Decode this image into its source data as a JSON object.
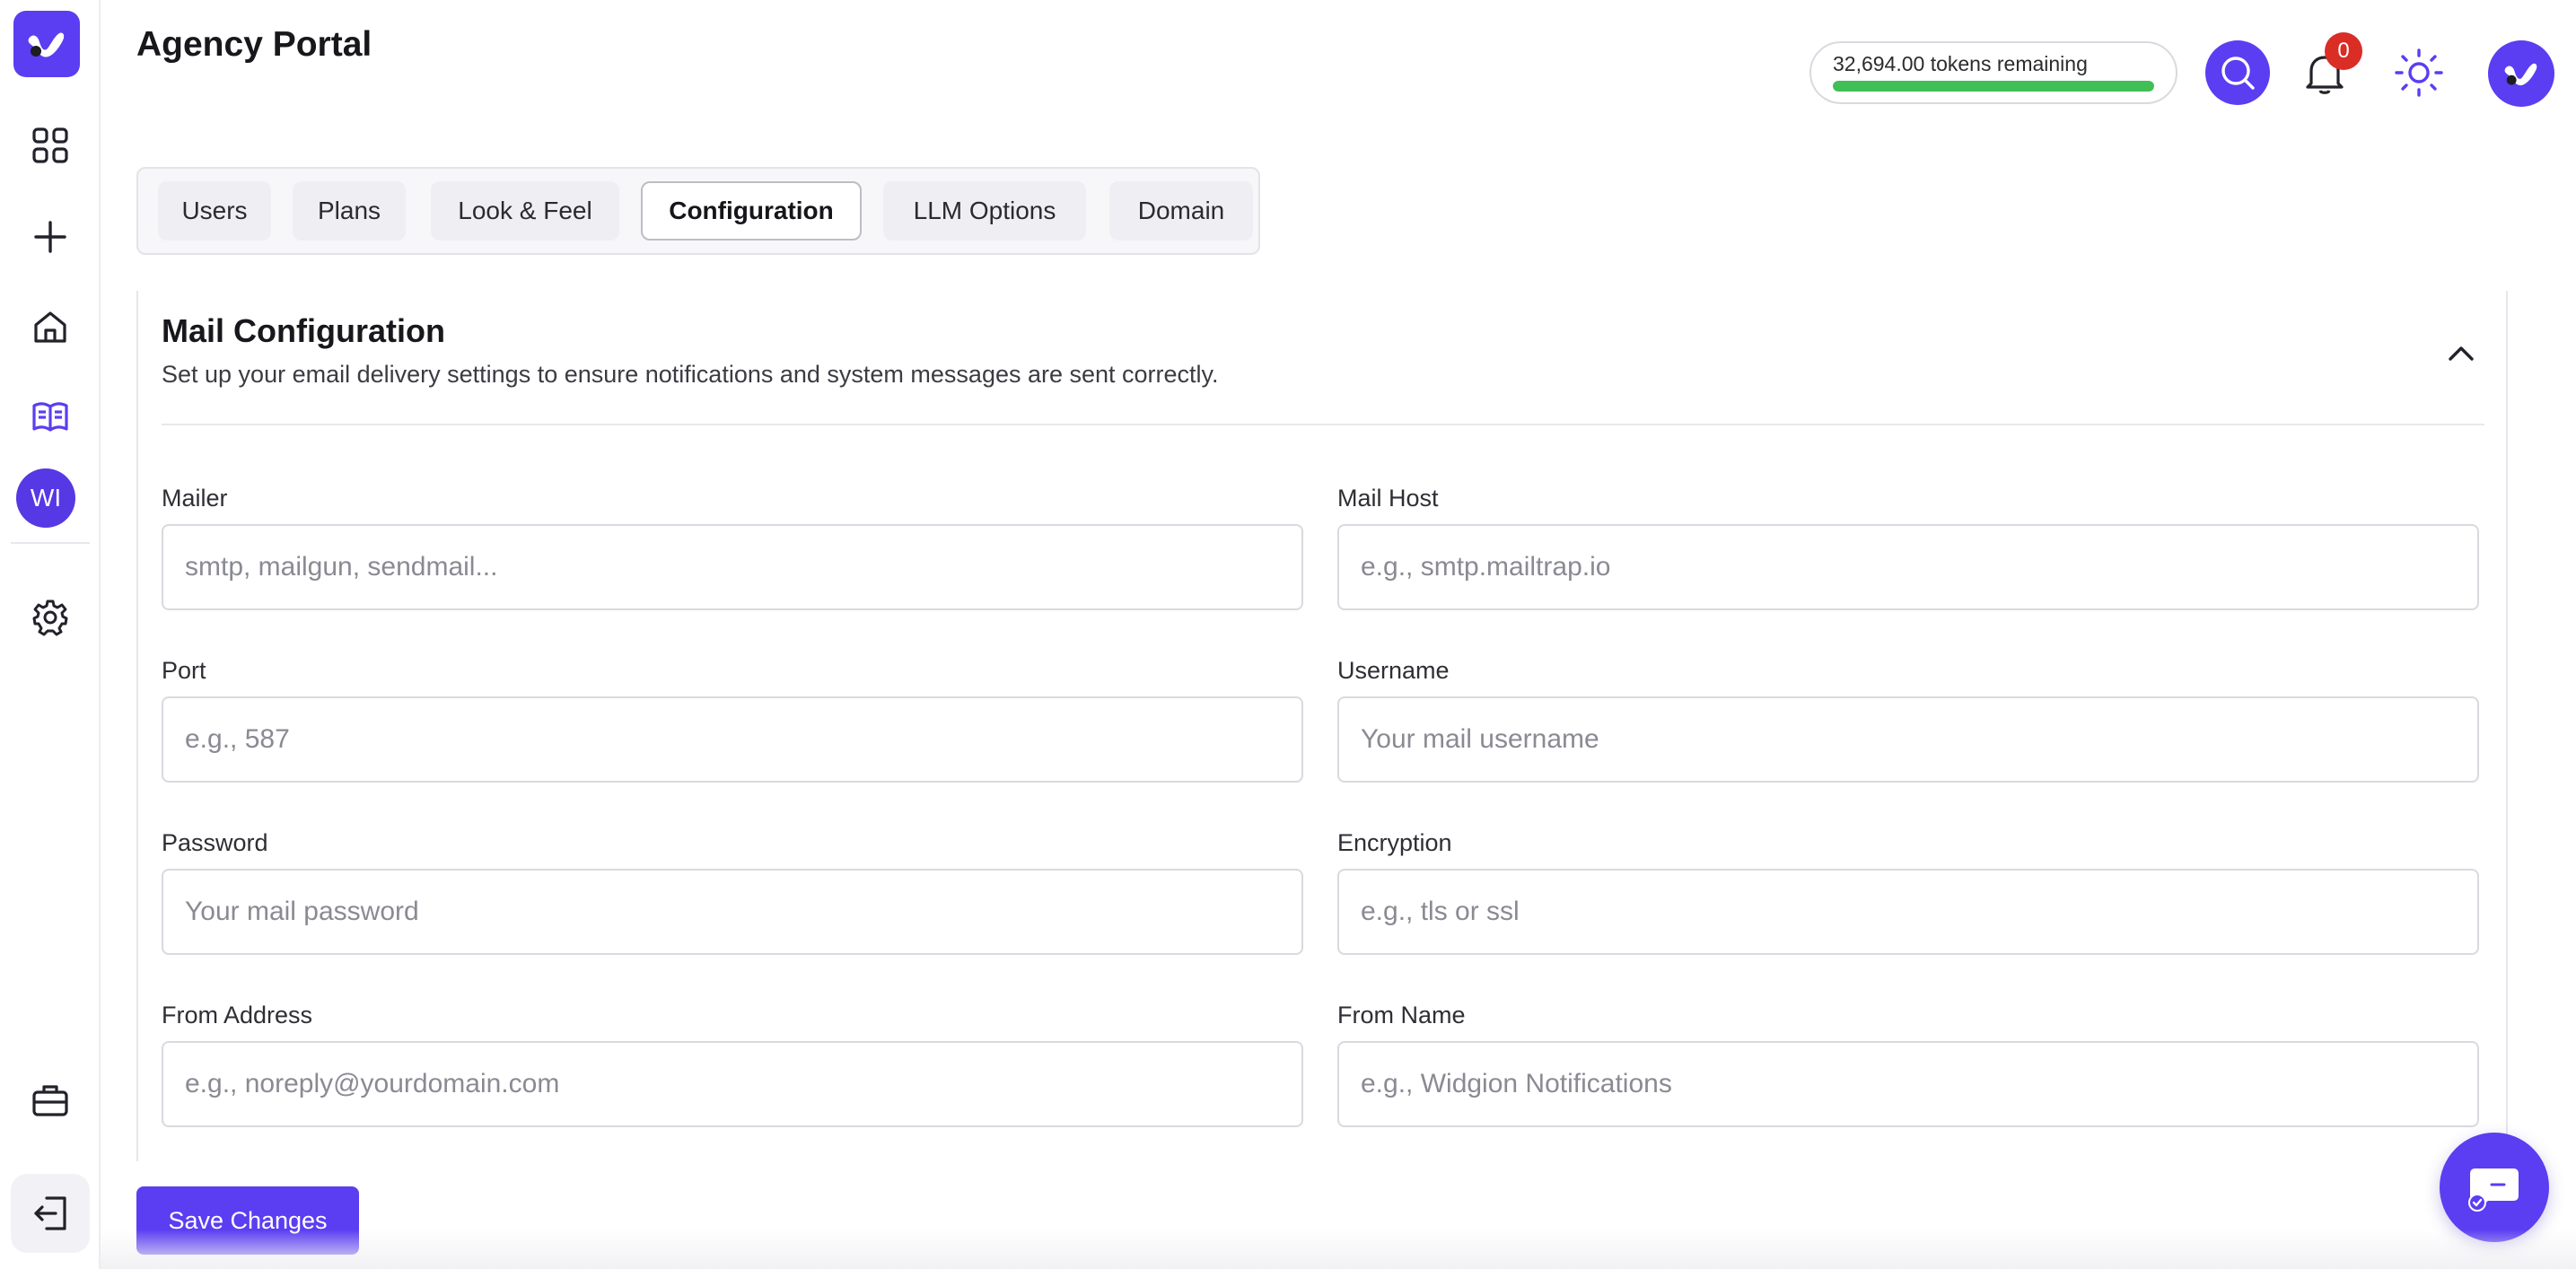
{
  "header": {
    "title": "Agency Portal",
    "tokens_text": "32,694.00 tokens remaining",
    "tokens_fill_percent": 100,
    "notification_count": "0"
  },
  "sidebar": {
    "avatar_initials": "WI",
    "items": [
      {
        "icon": "grid-icon"
      },
      {
        "icon": "plus-icon"
      },
      {
        "icon": "home-icon"
      },
      {
        "icon": "book-icon"
      },
      {
        "icon": "gear-icon"
      },
      {
        "icon": "briefcase-icon"
      },
      {
        "icon": "logout-icon"
      }
    ]
  },
  "tabs": [
    {
      "label": "Users"
    },
    {
      "label": "Plans"
    },
    {
      "label": "Look & Feel"
    },
    {
      "label": "Configuration",
      "active": true
    },
    {
      "label": "LLM Options"
    },
    {
      "label": "Domain"
    }
  ],
  "section": {
    "title": "Mail Configuration",
    "subtitle": "Set up your email delivery settings to ensure notifications and system messages are sent correctly."
  },
  "fields": {
    "mailer": {
      "label": "Mailer",
      "placeholder": "smtp, mailgun, sendmail...",
      "value": ""
    },
    "mail_host": {
      "label": "Mail Host",
      "placeholder": "e.g., smtp.mailtrap.io",
      "value": ""
    },
    "port": {
      "label": "Port",
      "placeholder": "e.g., 587",
      "value": ""
    },
    "username": {
      "label": "Username",
      "placeholder": "Your mail username",
      "value": ""
    },
    "password": {
      "label": "Password",
      "placeholder": "Your mail password",
      "value": ""
    },
    "encryption": {
      "label": "Encryption",
      "placeholder": "e.g., tls or ssl",
      "value": ""
    },
    "from_address": {
      "label": "From Address",
      "placeholder": "e.g., noreply@yourdomain.com",
      "value": ""
    },
    "from_name": {
      "label": "From Name",
      "placeholder": "e.g., Widgion Notifications",
      "value": ""
    }
  },
  "actions": {
    "save_label": "Save Changes"
  },
  "colors": {
    "brand": "#5b3df2",
    "progress": "#3fbf55",
    "badge": "#d92d26"
  }
}
